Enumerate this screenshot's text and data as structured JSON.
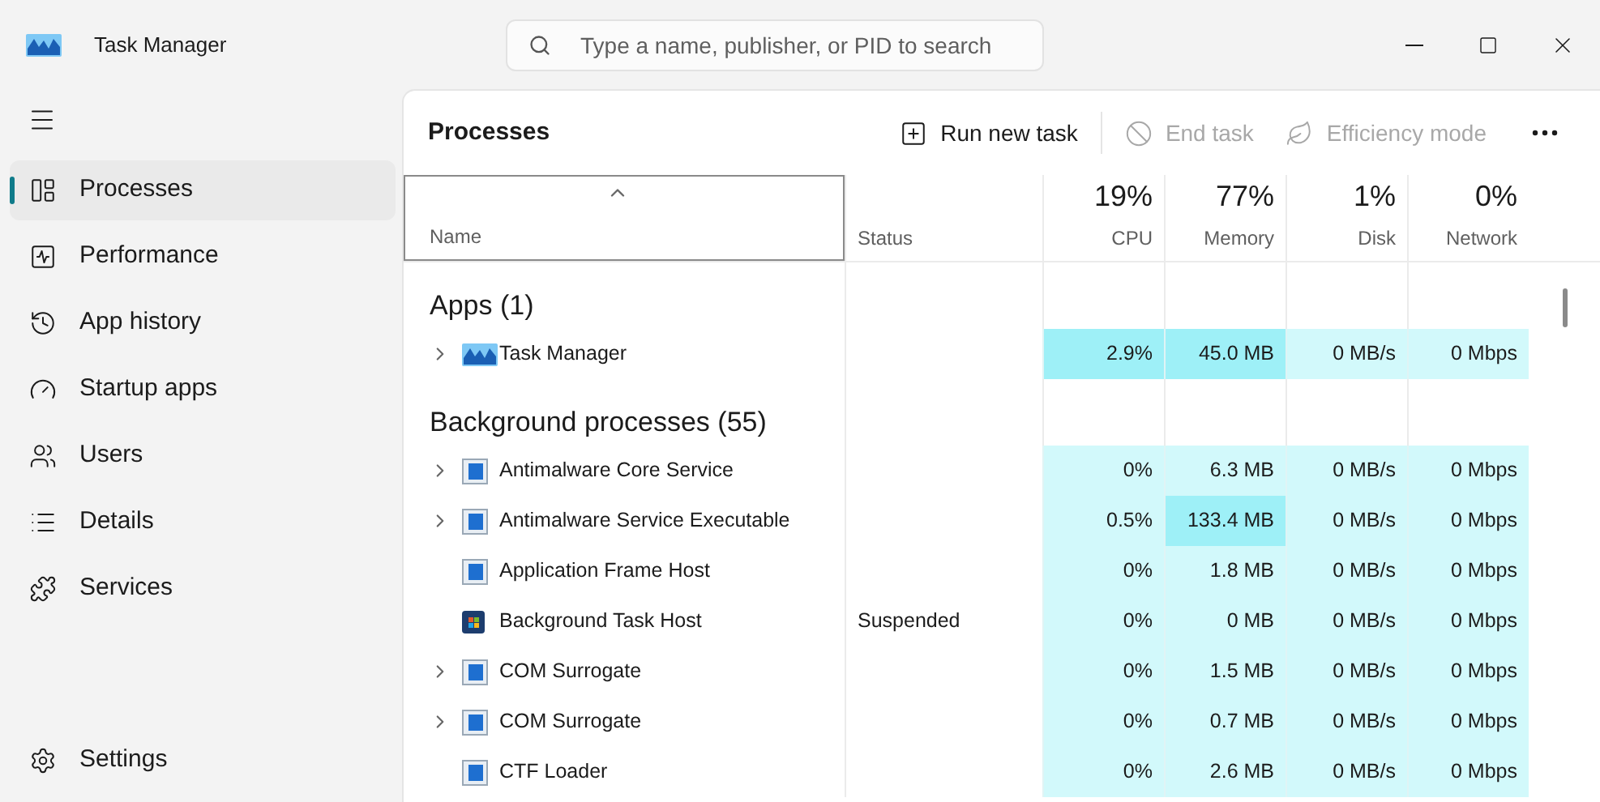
{
  "window": {
    "title": "Task Manager"
  },
  "search": {
    "placeholder": "Type a name, publisher, or PID to search"
  },
  "sidebar": {
    "items": [
      {
        "label": "Processes",
        "selected": true
      },
      {
        "label": "Performance",
        "selected": false
      },
      {
        "label": "App history",
        "selected": false
      },
      {
        "label": "Startup apps",
        "selected": false
      },
      {
        "label": "Users",
        "selected": false
      },
      {
        "label": "Details",
        "selected": false
      },
      {
        "label": "Services",
        "selected": false
      }
    ],
    "footer": {
      "label": "Settings"
    }
  },
  "page": {
    "title": "Processes"
  },
  "toolbar": [
    {
      "label": "Run new task",
      "disabled": false
    },
    {
      "label": "End task",
      "disabled": true
    },
    {
      "label": "Efficiency mode",
      "disabled": true
    }
  ],
  "table": {
    "columns": [
      {
        "label": "Name",
        "sorted": true
      },
      {
        "label": "Status",
        "sorted": false
      },
      {
        "label": "CPU",
        "total": "19%",
        "sorted": false
      },
      {
        "label": "Memory",
        "total": "77%",
        "sorted": false
      },
      {
        "label": "Disk",
        "total": "1%",
        "sorted": false
      },
      {
        "label": "Network",
        "total": "0%",
        "sorted": false
      }
    ],
    "groups": [
      {
        "title": "Apps (1)",
        "rows": [
          {
            "name": "Task Manager",
            "kind": "app",
            "expandable": true,
            "cells": [
              {
                "text": "2.9%",
                "highlighted": true
              },
              {
                "text": "45.0 MB",
                "highlighted": true
              },
              {
                "text": "0 MB/s",
                "highlighted": false
              },
              {
                "text": "0 Mbps",
                "highlighted": false
              }
            ]
          }
        ]
      },
      {
        "title": "Background processes (55)",
        "rows": [
          {
            "name": "Antimalware Core Service",
            "kind": "window",
            "expandable": true,
            "cells": [
              {
                "text": "0%",
                "highlighted": false
              },
              {
                "text": "6.3 MB",
                "highlighted": false
              },
              {
                "text": "0 MB/s",
                "highlighted": false
              },
              {
                "text": "0 Mbps",
                "highlighted": false
              }
            ]
          },
          {
            "name": "Antimalware Service Executable",
            "kind": "window",
            "expandable": true,
            "cells": [
              {
                "text": "0.5%",
                "highlighted": false
              },
              {
                "text": "133.4 MB",
                "highlighted": true
              },
              {
                "text": "0 MB/s",
                "highlighted": false
              },
              {
                "text": "0 Mbps",
                "highlighted": false
              }
            ]
          },
          {
            "name": "Application Frame Host",
            "kind": "window",
            "expandable": false,
            "cells": [
              {
                "text": "0%",
                "highlighted": false
              },
              {
                "text": "1.8 MB",
                "highlighted": false
              },
              {
                "text": "0 MB/s",
                "highlighted": false
              },
              {
                "text": "0 Mbps",
                "highlighted": false
              }
            ]
          },
          {
            "name": "Background Task Host",
            "kind": "tile",
            "expandable": false,
            "status": "Suspended",
            "cells": [
              {
                "text": "0%",
                "highlighted": false
              },
              {
                "text": "0 MB",
                "highlighted": false
              },
              {
                "text": "0 MB/s",
                "highlighted": false
              },
              {
                "text": "0 Mbps",
                "highlighted": false
              }
            ]
          },
          {
            "name": "COM Surrogate",
            "kind": "window",
            "expandable": true,
            "cells": [
              {
                "text": "0%",
                "highlighted": false
              },
              {
                "text": "1.5 MB",
                "highlighted": false
              },
              {
                "text": "0 MB/s",
                "highlighted": false
              },
              {
                "text": "0 Mbps",
                "highlighted": false
              }
            ]
          },
          {
            "name": "COM Surrogate",
            "kind": "window",
            "expandable": true,
            "cells": [
              {
                "text": "0%",
                "highlighted": false
              },
              {
                "text": "0.7 MB",
                "highlighted": false
              },
              {
                "text": "0 MB/s",
                "highlighted": false
              },
              {
                "text": "0 Mbps",
                "highlighted": false
              }
            ]
          },
          {
            "name": "CTF Loader",
            "kind": "window",
            "expandable": false,
            "cells": [
              {
                "text": "0%",
                "highlighted": false
              },
              {
                "text": "2.6 MB",
                "highlighted": false
              },
              {
                "text": "0 MB/s",
                "highlighted": false
              },
              {
                "text": "0 Mbps",
                "highlighted": false
              }
            ]
          }
        ]
      }
    ]
  }
}
